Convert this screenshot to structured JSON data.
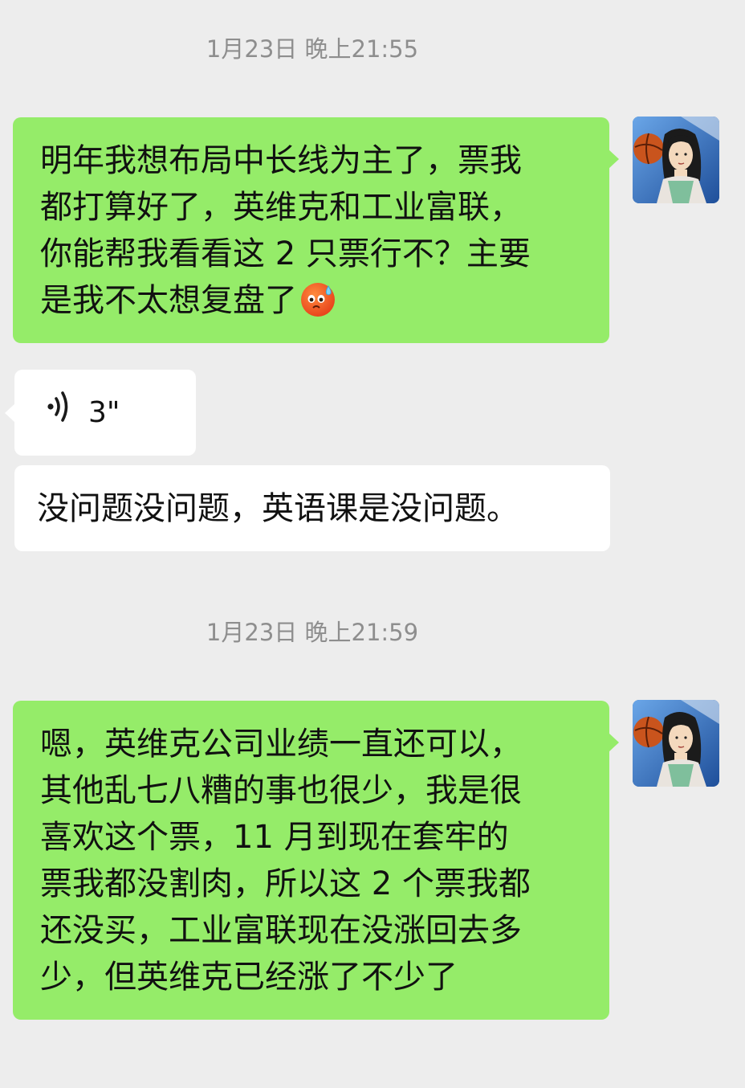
{
  "timestamps": [
    {
      "text": "1月23日 晚上21:55"
    },
    {
      "text": "1月23日 晚上21:59"
    }
  ],
  "messages": {
    "m1": {
      "lines": [
        "明年我想布局中长线为主了，票我",
        "都打算好了，英维克和工业富联，",
        "你能帮我看看这 2 只票行不？主要",
        "是我不太想复盘了"
      ],
      "emoji": "sweat-face-emoji"
    },
    "voice": {
      "duration": "3\""
    },
    "m3": {
      "text": "没问题没问题，英语课是没问题。"
    },
    "m4": {
      "lines": [
        "嗯，英维克公司业绩一直还可以，",
        "其他乱七八糟的事也很少，我是很",
        "喜欢这个票，11 月到现在套牢的",
        "票我都没割肉，所以这 2 个票我都",
        "还没买，工业富联现在没涨回去多",
        "少，但英维克已经涨了不少了"
      ]
    }
  },
  "colors": {
    "background": "#ededed",
    "sent_bubble": "#95ec69",
    "received_bubble": "#ffffff",
    "timestamp_text": "#8e8e8e"
  },
  "icons": {
    "voice": "voice-wave-icon",
    "avatar": "avatar-image"
  }
}
